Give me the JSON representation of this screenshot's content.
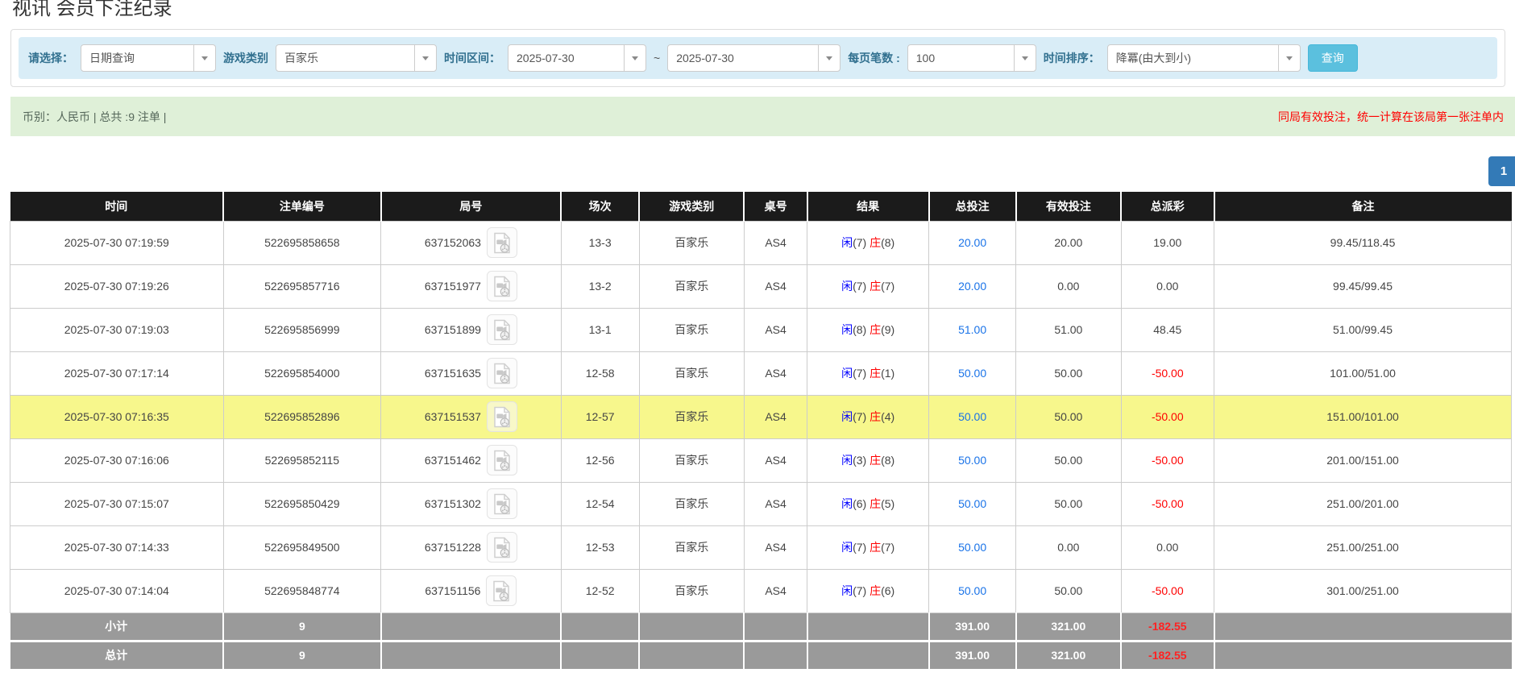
{
  "page": {
    "title": "视讯 会员下注纪录"
  },
  "filters": {
    "query_type_label": "请选择：",
    "query_type_value": "日期查询",
    "game_type_label": "游戏类别",
    "game_type_value": "百家乐",
    "date_range_label": "时间区间：",
    "date_from": "2025-07-30",
    "range_separator": "~",
    "date_to": "2025-07-30",
    "page_size_label": "每页笔数 :",
    "page_size_value": "100",
    "sort_label": "时间排序：",
    "sort_value": "降冪(由大到小)",
    "search_button": "查询"
  },
  "summary": {
    "left_text": "币别：人民币 | 总共 :9 注单 |",
    "right_notice": "同局有效投注，统一计算在该局第一张注单内"
  },
  "pagination": {
    "current_page": "1"
  },
  "table": {
    "headers": [
      "时间",
      "注单编号",
      "局号",
      "场次",
      "游戏类别",
      "桌号",
      "结果",
      "总投注",
      "有效投注",
      "总派彩",
      "备注"
    ],
    "result_labels": {
      "player": "闲",
      "banker": "庄"
    },
    "rows": [
      {
        "time": "2025-07-30 07:19:59",
        "bet_id": "522695858658",
        "round_id": "637152063",
        "session": "13-3",
        "game": "百家乐",
        "table_no": "AS4",
        "result": {
          "player": "7",
          "banker": "8"
        },
        "total_bet": "20.00",
        "valid_bet": "20.00",
        "payout": "19.00",
        "remark": "99.45/118.45",
        "highlight": false
      },
      {
        "time": "2025-07-30 07:19:26",
        "bet_id": "522695857716",
        "round_id": "637151977",
        "session": "13-2",
        "game": "百家乐",
        "table_no": "AS4",
        "result": {
          "player": "7",
          "banker": "7"
        },
        "total_bet": "20.00",
        "valid_bet": "0.00",
        "payout": "0.00",
        "remark": "99.45/99.45",
        "highlight": false
      },
      {
        "time": "2025-07-30 07:19:03",
        "bet_id": "522695856999",
        "round_id": "637151899",
        "session": "13-1",
        "game": "百家乐",
        "table_no": "AS4",
        "result": {
          "player": "8",
          "banker": "9"
        },
        "total_bet": "51.00",
        "valid_bet": "51.00",
        "payout": "48.45",
        "remark": "51.00/99.45",
        "highlight": false
      },
      {
        "time": "2025-07-30 07:17:14",
        "bet_id": "522695854000",
        "round_id": "637151635",
        "session": "12-58",
        "game": "百家乐",
        "table_no": "AS4",
        "result": {
          "player": "7",
          "banker": "1"
        },
        "total_bet": "50.00",
        "valid_bet": "50.00",
        "payout": "-50.00",
        "remark": "101.00/51.00",
        "highlight": false
      },
      {
        "time": "2025-07-30 07:16:35",
        "bet_id": "522695852896",
        "round_id": "637151537",
        "session": "12-57",
        "game": "百家乐",
        "table_no": "AS4",
        "result": {
          "player": "7",
          "banker": "4"
        },
        "total_bet": "50.00",
        "valid_bet": "50.00",
        "payout": "-50.00",
        "remark": "151.00/101.00",
        "highlight": true
      },
      {
        "time": "2025-07-30 07:16:06",
        "bet_id": "522695852115",
        "round_id": "637151462",
        "session": "12-56",
        "game": "百家乐",
        "table_no": "AS4",
        "result": {
          "player": "3",
          "banker": "8"
        },
        "total_bet": "50.00",
        "valid_bet": "50.00",
        "payout": "-50.00",
        "remark": "201.00/151.00",
        "highlight": false
      },
      {
        "time": "2025-07-30 07:15:07",
        "bet_id": "522695850429",
        "round_id": "637151302",
        "session": "12-54",
        "game": "百家乐",
        "table_no": "AS4",
        "result": {
          "player": "6",
          "banker": "5"
        },
        "total_bet": "50.00",
        "valid_bet": "50.00",
        "payout": "-50.00",
        "remark": "251.00/201.00",
        "highlight": false
      },
      {
        "time": "2025-07-30 07:14:33",
        "bet_id": "522695849500",
        "round_id": "637151228",
        "session": "12-53",
        "game": "百家乐",
        "table_no": "AS4",
        "result": {
          "player": "7",
          "banker": "7"
        },
        "total_bet": "50.00",
        "valid_bet": "0.00",
        "payout": "0.00",
        "remark": "251.00/251.00",
        "highlight": false
      },
      {
        "time": "2025-07-30 07:14:04",
        "bet_id": "522695848774",
        "round_id": "637151156",
        "session": "12-52",
        "game": "百家乐",
        "table_no": "AS4",
        "result": {
          "player": "7",
          "banker": "6"
        },
        "total_bet": "50.00",
        "valid_bet": "50.00",
        "payout": "-50.00",
        "remark": "301.00/251.00",
        "highlight": false
      }
    ],
    "subtotal": {
      "label": "小计",
      "count": "9",
      "total_bet": "391.00",
      "valid_bet": "321.00",
      "payout": "-182.55",
      "remark": ""
    },
    "total": {
      "label": "总计",
      "count": "9",
      "total_bet": "391.00",
      "valid_bet": "321.00",
      "payout": "-182.55",
      "remark": ""
    }
  },
  "colors": {
    "accent_blue": "#337ab7",
    "button_cyan": "#5bc0de",
    "info_bg": "#d9edf7",
    "info_text": "#31708f",
    "success_bg": "#dff0d8",
    "alert_red": "#ff0000",
    "link_blue": "#1a73e8",
    "player_blue": "#0000ff",
    "banker_red": "#ff0000",
    "highlight_yellow": "#f7f78c",
    "header_bg": "#1b1b1b",
    "footer_bg": "#9a9a9a"
  }
}
